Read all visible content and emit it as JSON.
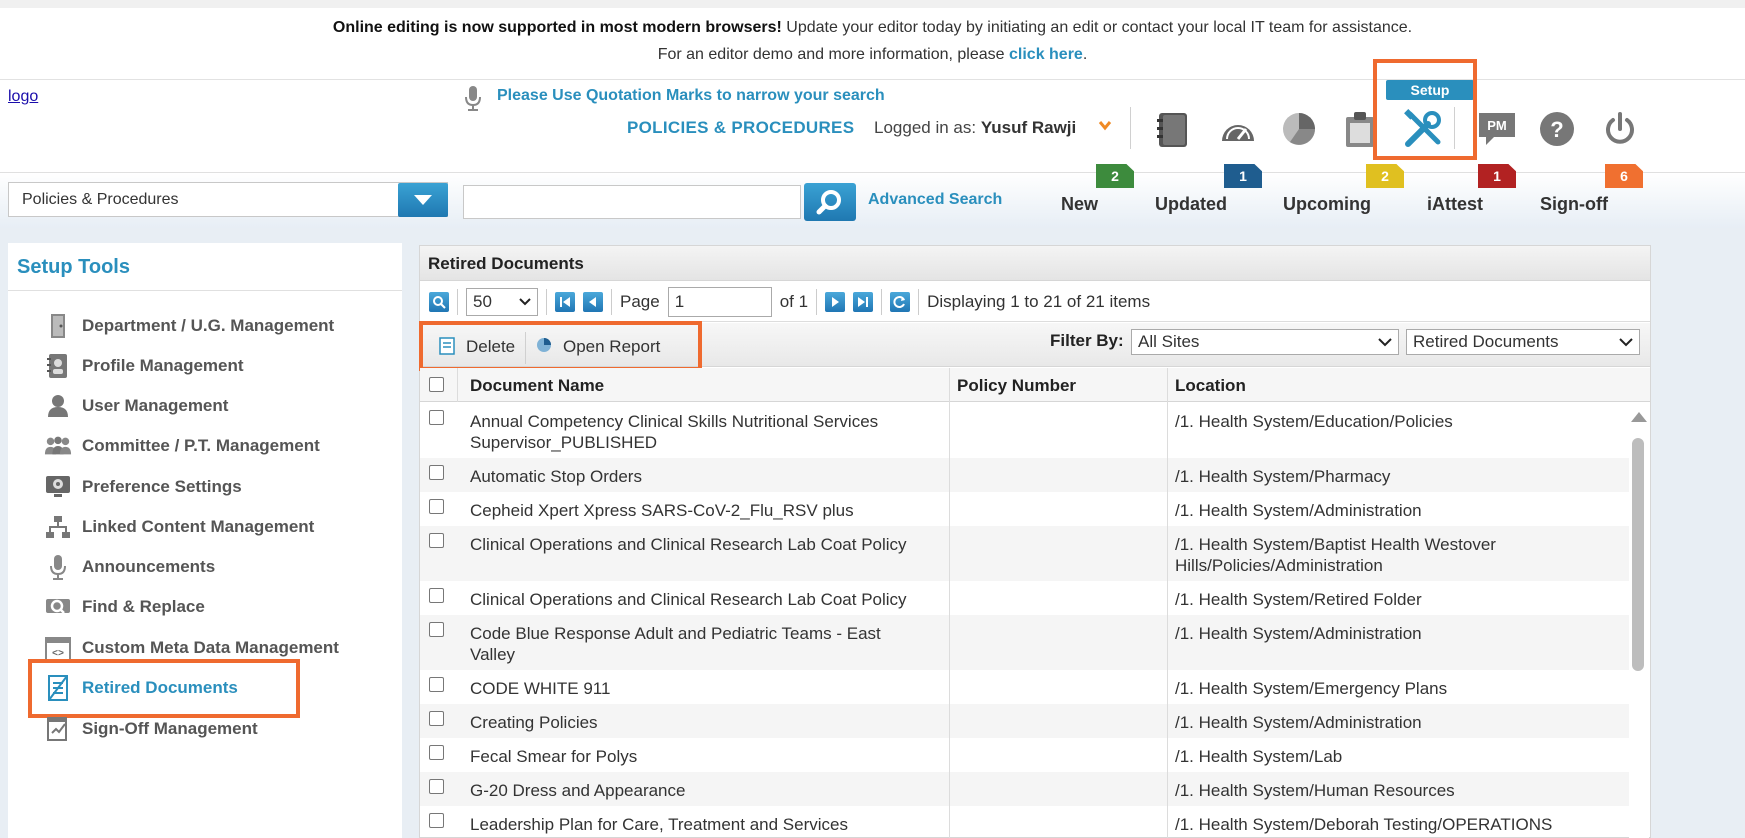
{
  "banner": {
    "line1_bold": "Online editing is now supported in most modern browsers!",
    "line1_rest": " Update your editor today by initiating an edit or contact your local IT team for assistance.",
    "line2_text": "For an editor demo and more information, please ",
    "line2_link": "click here",
    "line2_end": "."
  },
  "header": {
    "logo_alt": "logo",
    "search_tip": "Please Use Quotation Marks to narrow your search",
    "module_title": "POLICIES & PROCEDURES",
    "logged_in_label": "Logged in as:",
    "user_name": "Yusuf Rawji",
    "setup_label": "Setup",
    "icons": [
      "binder-icon",
      "dashboard-icon",
      "pie-chart-icon",
      "clipboard-icon",
      "tools-icon",
      "pm-chat-icon",
      "help-icon",
      "power-icon"
    ]
  },
  "search": {
    "scope_value": "Policies & Procedures",
    "query": "",
    "advanced_label": "Advanced Search"
  },
  "stats": [
    {
      "label": "New",
      "count": "2",
      "color": "#3d8b3d"
    },
    {
      "label": "Updated",
      "count": "1",
      "color": "#1f5d8f"
    },
    {
      "label": "Upcoming",
      "count": "2",
      "color": "#e0c020"
    },
    {
      "label": "iAttest",
      "count": "1",
      "color": "#b22222"
    },
    {
      "label": "Sign-off",
      "count": "6",
      "color": "#f07030"
    }
  ],
  "sidebar": {
    "title": "Setup Tools",
    "items": [
      {
        "label": "Department / U.G. Management",
        "icon": "door-icon"
      },
      {
        "label": "Profile Management",
        "icon": "address-book-icon"
      },
      {
        "label": "User Management",
        "icon": "user-icon"
      },
      {
        "label": "Committee / P.T. Management",
        "icon": "group-icon"
      },
      {
        "label": "Preference Settings",
        "icon": "monitor-gear-icon"
      },
      {
        "label": "Linked Content Management",
        "icon": "sitemap-icon"
      },
      {
        "label": "Announcements",
        "icon": "microphone-icon"
      },
      {
        "label": "Find & Replace",
        "icon": "find-replace-icon"
      },
      {
        "label": "Custom Meta Data Management",
        "icon": "code-window-icon"
      },
      {
        "label": "Retired Documents",
        "icon": "retired-document-icon"
      },
      {
        "label": "Sign-Off Management",
        "icon": "sign-off-icon"
      }
    ],
    "active_index": 9
  },
  "panel": {
    "title": "Retired Documents",
    "page_size": "50",
    "page_label": "Page",
    "page_value": "1",
    "of_label": "of 1",
    "display_text": "Displaying 1 to 21 of 21 items",
    "delete_label": "Delete",
    "open_report_label": "Open Report",
    "filter_label": "Filter By:",
    "filter_site": "All Sites",
    "filter_type": "Retired Documents"
  },
  "grid": {
    "columns": [
      "Document Name",
      "Policy Number",
      "Location"
    ],
    "rows": [
      {
        "name": "Annual Competency Clinical Skills Nutritional Services Supervisor_PUBLISHED",
        "policy": "",
        "location": "/1. Health System/Education/Policies"
      },
      {
        "name": "Automatic Stop Orders",
        "policy": "",
        "location": "/1. Health System/Pharmacy"
      },
      {
        "name": "Cepheid Xpert Xpress SARS-CoV-2_Flu_RSV plus",
        "policy": "",
        "location": "/1. Health System/Administration"
      },
      {
        "name": "Clinical Operations and Clinical Research Lab Coat Policy",
        "policy": "",
        "location": "/1. Health System/Baptist Health Westover Hills/Policies/Administration"
      },
      {
        "name": "Clinical Operations and Clinical Research Lab Coat Policy",
        "policy": "",
        "location": "/1. Health System/Retired Folder"
      },
      {
        "name": "Code Blue Response Adult and Pediatric Teams - East Valley",
        "policy": "",
        "location": "/1. Health System/Administration"
      },
      {
        "name": "CODE WHITE 911",
        "policy": "",
        "location": "/1. Health System/Emergency Plans"
      },
      {
        "name": "Creating Policies",
        "policy": "",
        "location": "/1. Health System/Administration"
      },
      {
        "name": "Fecal Smear for Polys",
        "policy": "",
        "location": "/1. Health System/Lab"
      },
      {
        "name": "G-20 Dress and Appearance",
        "policy": "",
        "location": "/1. Health System/Human Resources"
      },
      {
        "name": "Leadership Plan for Care, Treatment and Services",
        "policy": "",
        "location": "/1. Health System/Deborah Testing/OPERATIONS"
      }
    ]
  }
}
